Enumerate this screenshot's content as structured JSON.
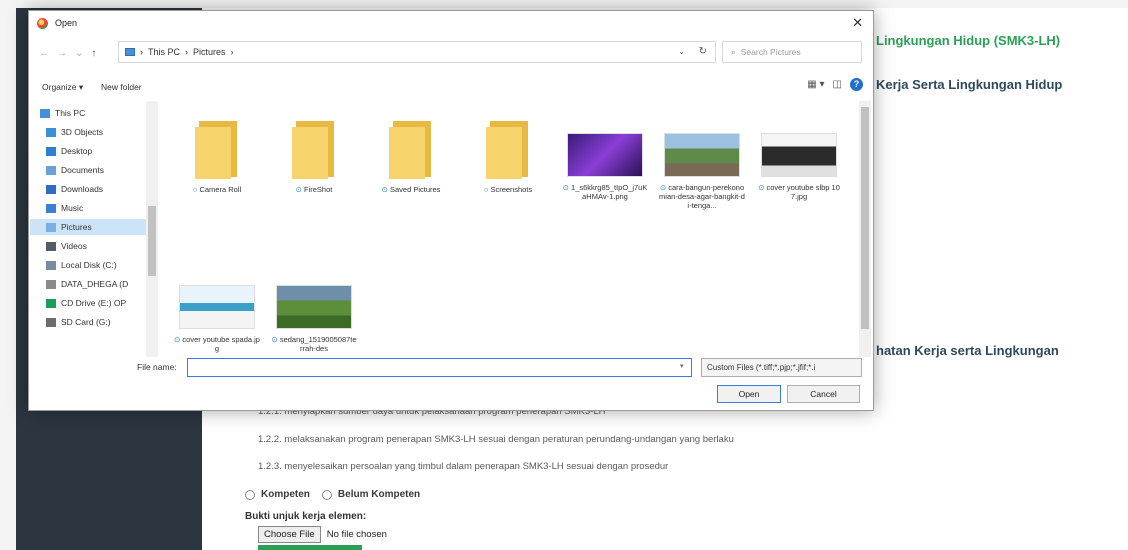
{
  "window": {
    "title": "Open"
  },
  "address": {
    "crumbs": [
      "This PC",
      "Pictures"
    ],
    "search_placeholder": "Search Pictures"
  },
  "commands": {
    "organize": "Organize ▾",
    "new_folder": "New folder"
  },
  "navpane": {
    "items": [
      {
        "label": "This PC",
        "color": "#4a90d9"
      },
      {
        "label": "3D Objects",
        "color": "#3b8fd9"
      },
      {
        "label": "Desktop",
        "color": "#2f7fd1"
      },
      {
        "label": "Documents",
        "color": "#6aa0d8"
      },
      {
        "label": "Downloads",
        "color": "#2f6fc1"
      },
      {
        "label": "Music",
        "color": "#3b7fd0"
      },
      {
        "label": "Pictures",
        "color": "#7ab0e0",
        "selected": true
      },
      {
        "label": "Videos",
        "color": "#555a66"
      },
      {
        "label": "Local Disk (C:)",
        "color": "#7a8aa0"
      },
      {
        "label": "DATA_DHEGA (D",
        "color": "#8a8a8a"
      },
      {
        "label": "CD Drive (E:) OP",
        "color": "#1e9c5a"
      },
      {
        "label": "SD Card (G:)",
        "color": "#6d6d6d"
      }
    ]
  },
  "files": [
    {
      "label": "Camera Roll",
      "kind": "folder",
      "status": "○"
    },
    {
      "label": "FireShot",
      "kind": "folder",
      "status": "⊙"
    },
    {
      "label": "Saved Pictures",
      "kind": "folder",
      "status": "⊙"
    },
    {
      "label": "Screenshots",
      "kind": "folder",
      "status": "○"
    },
    {
      "label": "1_s6kkrg85_tIpO_j7uKaHMAv-1.png",
      "kind": "image",
      "status": "⊙",
      "thumb": "purple"
    },
    {
      "label": "cara-bangun-perekonomian-desa-agar-bangkit-di-tenga...",
      "kind": "image",
      "status": "⊙",
      "thumb": "village"
    },
    {
      "label": "cover youtube slbp 107.jpg",
      "kind": "image",
      "status": "⊙",
      "thumb": "cover"
    },
    {
      "label": "cover youtube spada.jpg",
      "kind": "image",
      "status": "⊙",
      "thumb": "spada"
    },
    {
      "label": "sedang_1519005087terrah-des",
      "kind": "image",
      "status": "⊙",
      "thumb": "landscape"
    }
  ],
  "filename": {
    "label": "File name:",
    "value": ""
  },
  "filter": {
    "value": "Custom Files (*.tiff;*.pjp;*.jfif;*.i"
  },
  "buttons": {
    "open": "Open",
    "cancel": "Cancel"
  },
  "page": {
    "heading_1": "Lingkungan Hidup (SMK3-LH)",
    "heading_2": "Kerja Serta Lingkungan Hidup",
    "heading_3": "hatan Kerja serta Lingkungan",
    "line_1": "1.2.1. menyiapkan sumber daya untuk pelaksanaan program penerapan SMK3-LH",
    "line_2": "1.2.2. melaksanakan program penerapan SMK3-LH sesuai dengan peraturan perundang-undangan yang berlaku",
    "line_3": "1.2.3. menyelesaikan persoalan yang timbul dalam penerapan SMK3-LH sesuai dengan prosedur",
    "radio_1": "Kompeten",
    "radio_2": "Belum Kompeten",
    "bukti_label": "Bukti unjuk kerja elemen:",
    "choose_file": "Choose File",
    "no_file": "No file chosen"
  }
}
